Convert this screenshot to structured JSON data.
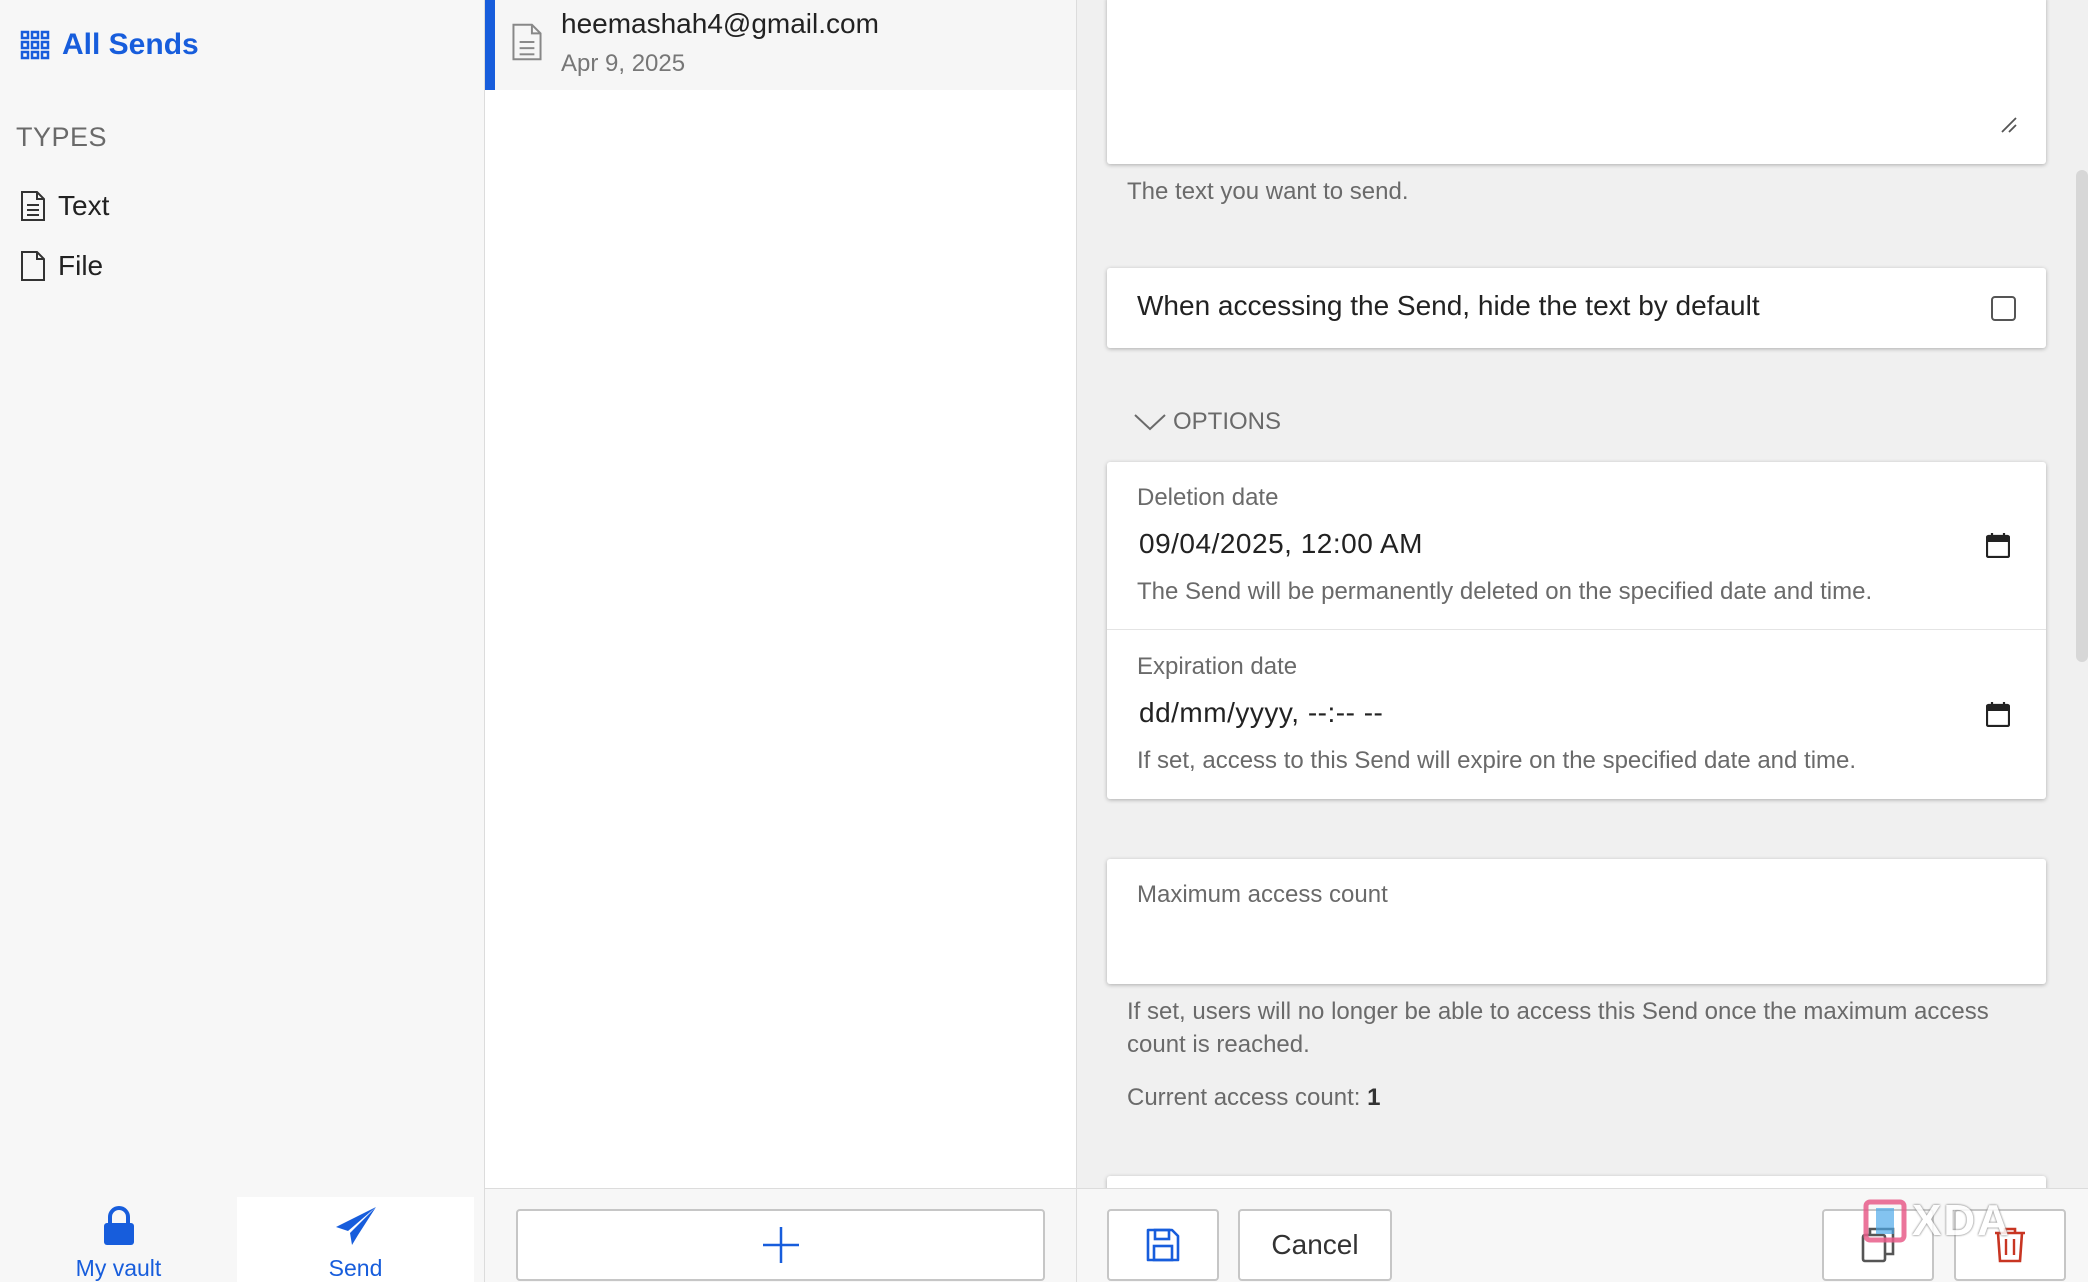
{
  "sidebar": {
    "all_sends_label": "All Sends",
    "types_heading": "TYPES",
    "types": [
      {
        "label": "Text",
        "icon": "text-document-icon"
      },
      {
        "label": "File",
        "icon": "file-icon"
      }
    ],
    "nav": [
      {
        "label": "My vault",
        "icon": "lock-icon"
      },
      {
        "label": "Send",
        "icon": "paper-plane-icon",
        "active": true
      }
    ]
  },
  "list": {
    "items": [
      {
        "title": "heemashah4@gmail.com",
        "date": "Apr 9, 2025",
        "selected": true
      }
    ],
    "add_icon": "plus-icon"
  },
  "detail": {
    "text_hint": "The text you want to send.",
    "hide_text_label": "When accessing the Send, hide the text by default",
    "hide_text_checked": false,
    "options_label": "OPTIONS",
    "deletion": {
      "label": "Deletion date",
      "value": "09/04/2025, 12:00  AM",
      "hint": "The Send will be permanently deleted on the specified date and time."
    },
    "expiration": {
      "label": "Expiration date",
      "value": "dd/mm/yyyy, --:-- --",
      "hint": "If set, access to this Send will expire on the specified date and time."
    },
    "max_access": {
      "label": "Maximum access count",
      "hint": "If set, users will no longer be able to access this Send once the maximum access count is reached."
    },
    "current_access_label": "Current access count:",
    "current_access_value": "1"
  },
  "footer": {
    "cancel_label": "Cancel",
    "save_icon": "floppy-disk-icon",
    "copy_icon": "copy-icon",
    "delete_icon": "trash-icon"
  },
  "watermark": "XDA",
  "colors": {
    "accent": "#175ddc",
    "danger": "#c83522",
    "muted_text": "#6a6a6a"
  }
}
